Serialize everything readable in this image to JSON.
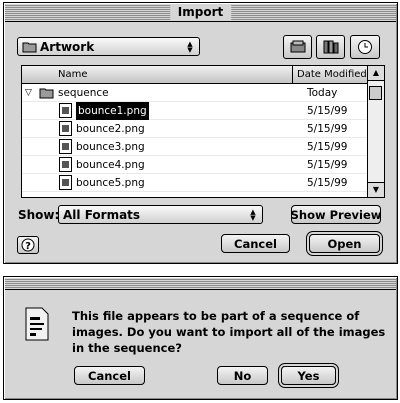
{
  "import_dialog": {
    "title": "Import",
    "location_popup": "Artwork",
    "columns": {
      "name": "Name",
      "date": "Date Modified"
    },
    "folder": {
      "name": "sequence",
      "date": "Today"
    },
    "files": [
      {
        "name": "bounce1.png",
        "date": "5/15/99",
        "selected": true
      },
      {
        "name": "bounce2.png",
        "date": "5/15/99"
      },
      {
        "name": "bounce3.png",
        "date": "5/15/99"
      },
      {
        "name": "bounce4.png",
        "date": "5/15/99"
      },
      {
        "name": "bounce5.png",
        "date": "5/15/99"
      }
    ],
    "show_label": "Show:",
    "show_value": "All Formats",
    "show_preview": "Show Preview",
    "cancel": "Cancel",
    "open": "Open",
    "help_icon": "question-mark-icon"
  },
  "alert_dialog": {
    "message": "This file appears to be part of a sequence of images. Do you want to import all of the images in the sequence?",
    "cancel": "Cancel",
    "no": "No",
    "yes": "Yes",
    "icon": "document-alert-icon"
  }
}
